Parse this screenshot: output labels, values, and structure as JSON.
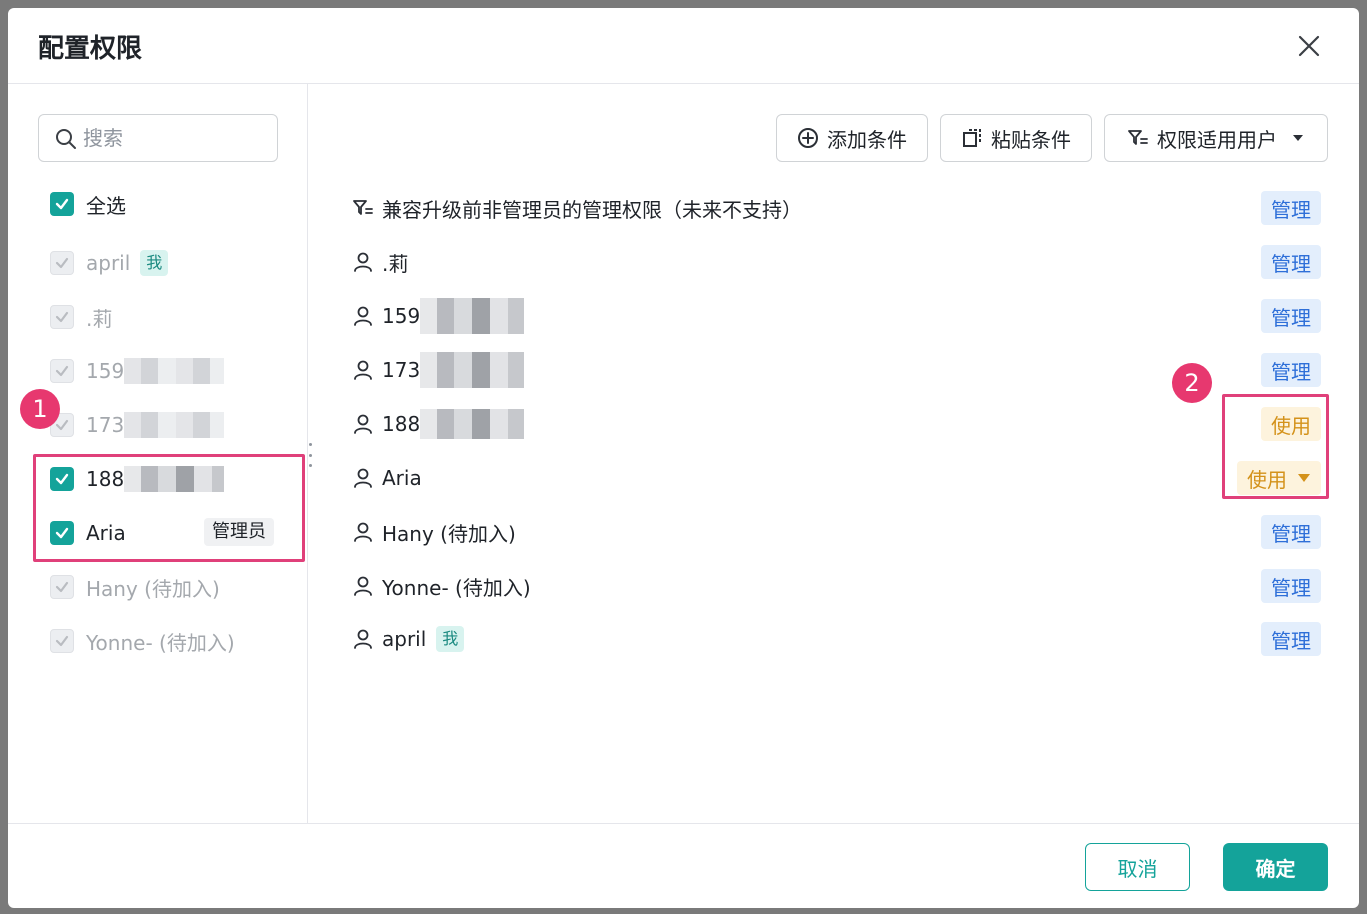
{
  "dialog": {
    "title": "配置权限"
  },
  "left": {
    "search_placeholder": "搜索",
    "select_all_label": "全选",
    "items": [
      {
        "label": "april",
        "badge": "我"
      },
      {
        "label": ".莉"
      },
      {
        "label": "159"
      },
      {
        "label": "173"
      },
      {
        "label": "188"
      },
      {
        "label": "Aria",
        "badge": "管理员"
      },
      {
        "label": "Hany (待加入)"
      },
      {
        "label": "Yonne- (待加入)"
      }
    ]
  },
  "toolbar": {
    "add_label": "添加条件",
    "paste_label": "粘贴条件",
    "scope_label": "权限适用用户"
  },
  "rules": [
    {
      "label": "兼容升级前非管理员的管理权限（未来不支持）",
      "perm": "管理"
    },
    {
      "label": ".莉",
      "perm": "管理"
    },
    {
      "label": "159",
      "perm": "管理"
    },
    {
      "label": "173",
      "perm": "管理"
    },
    {
      "label": "188",
      "perm": "使用"
    },
    {
      "label": "Aria",
      "perm": "使用"
    },
    {
      "label": "Hany (待加入)",
      "perm": "管理"
    },
    {
      "label": "Yonne- (待加入)",
      "perm": "管理"
    },
    {
      "label": "april",
      "badge": "我",
      "perm": "管理"
    }
  ],
  "annotations": {
    "badge_1": "1",
    "badge_2": "2"
  },
  "footer": {
    "cancel_label": "取消",
    "ok_label": "确定"
  },
  "colors": {
    "accent": "#14a39a",
    "manage": "#2e6fd8",
    "use": "#d4921a",
    "callout": "#e0407a"
  }
}
